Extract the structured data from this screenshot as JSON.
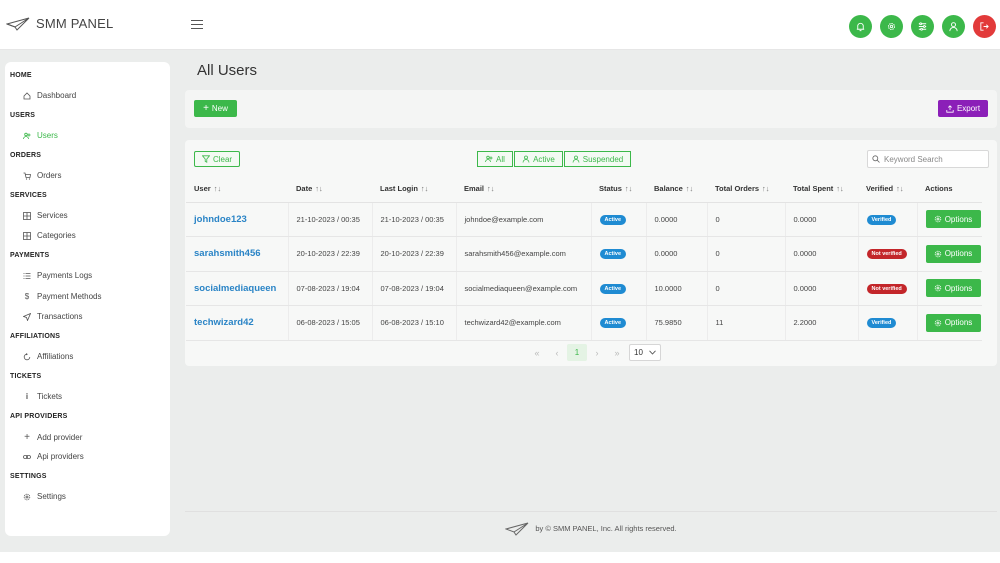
{
  "app": {
    "title": "SMM PANEL"
  },
  "colors": {
    "accent": "#3cb84a",
    "danger": "#e23a3a",
    "export": "#8b1fb8",
    "link": "#2a84c6",
    "badge_blue": "#1f8bd2",
    "badge_red": "#c3262a"
  },
  "header_icons": [
    {
      "name": "bell-icon",
      "color": "green"
    },
    {
      "name": "gear-icon",
      "color": "green"
    },
    {
      "name": "sliders-icon",
      "color": "green"
    },
    {
      "name": "user-icon",
      "color": "green"
    },
    {
      "name": "logout-icon",
      "color": "red"
    }
  ],
  "sidebar": {
    "home": "HOME",
    "dashboard": "Dashboard",
    "users_section": "USERS",
    "users": "Users",
    "orders_section": "ORDERS",
    "orders": "Orders",
    "services_section": "SERVICES",
    "services": "Services",
    "categories": "Categories",
    "payments_section": "PAYMENTS",
    "payments_logs": "Payments Logs",
    "payment_methods": "Payment Methods",
    "transactions": "Transactions",
    "affiliations_section": "AFFILIATIONS",
    "affiliations": "Affiliations",
    "tickets_section": "TICKETS",
    "tickets": "Tickets",
    "api_section": "API PROVIDERS",
    "add_provider": "Add provider",
    "api_providers": "Api providers",
    "settings_section": "SETTINGS",
    "settings": "Settings"
  },
  "page": {
    "title": "All Users"
  },
  "toolbar": {
    "new_label": "New",
    "export_label": "Export"
  },
  "filters": {
    "clear_label": "Clear",
    "all_label": "All",
    "active_label": "Active",
    "suspended_label": "Suspended",
    "search_placeholder": "Keyword Search"
  },
  "table": {
    "columns": [
      "User",
      "Date",
      "Last Login",
      "Email",
      "Status",
      "Balance",
      "Total Orders",
      "Total Spent",
      "Verified",
      "Actions"
    ],
    "sort_glyph": "↑↓",
    "options_label": "Options",
    "rows": [
      {
        "user": "johndoe123",
        "date": "21-10-2023 / 00:35",
        "last_login": "21-10-2023 / 00:35",
        "email": "johndoe@example.com",
        "status": "Active",
        "balance": "0.0000",
        "orders": "0",
        "spent": "0.0000",
        "verified": "Verified"
      },
      {
        "user": "sarahsmith456",
        "date": "20-10-2023 / 22:39",
        "last_login": "20-10-2023 / 22:39",
        "email": "sarahsmith456@example.com",
        "status": "Active",
        "balance": "0.0000",
        "orders": "0",
        "spent": "0.0000",
        "verified": "Not verified"
      },
      {
        "user": "socialmediaqueen",
        "date": "07-08-2023 / 19:04",
        "last_login": "07-08-2023 / 19:04",
        "email": "socialmediaqueen@example.com",
        "status": "Active",
        "balance": "10.0000",
        "orders": "0",
        "spent": "0.0000",
        "verified": "Not verified"
      },
      {
        "user": "techwizard42",
        "date": "06-08-2023 / 15:05",
        "last_login": "06-08-2023 / 15:10",
        "email": "techwizard42@example.com",
        "status": "Active",
        "balance": "75.9850",
        "orders": "11",
        "spent": "2.2000",
        "verified": "Verified"
      }
    ]
  },
  "pagination": {
    "first": "«",
    "prev": "‹",
    "current": "1",
    "next": "›",
    "last": "»",
    "page_size": "10"
  },
  "footer": {
    "text": "by © SMM PANEL, Inc. All rights reserved."
  }
}
